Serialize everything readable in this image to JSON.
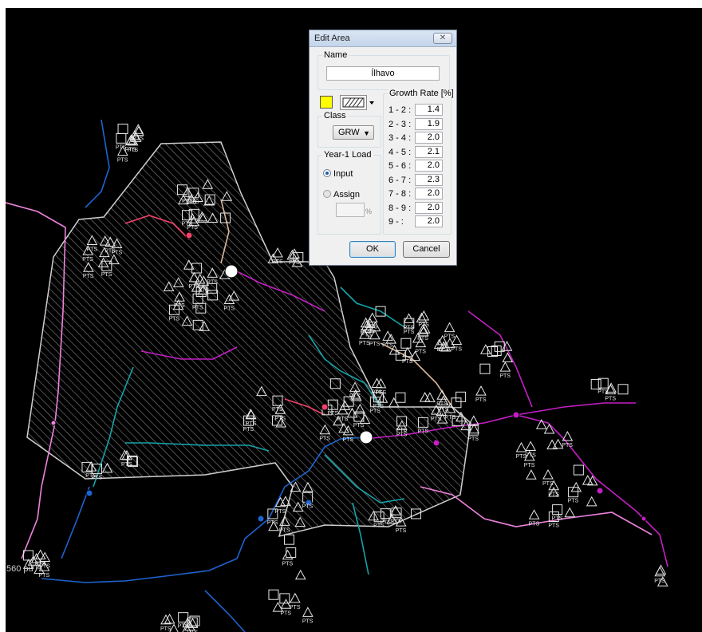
{
  "map": {
    "corner_label": "560 pu",
    "node_label": "PTS",
    "colors": {
      "background": "#000000",
      "area_outline": "#cfcfcf",
      "line_blue": "#1e64d0",
      "line_teal": "#15a3a8",
      "line_magenta": "#c41fc4",
      "line_pink": "#ee82dd",
      "line_tan": "#d9b79a",
      "line_red": "#f2426a"
    }
  },
  "dialog": {
    "title": "Edit Area",
    "close_glyph": "✕",
    "name_group_label": "Name",
    "name_value": "Ílhavo",
    "area_color": "#ffff00",
    "class_group_label": "Class",
    "class_value": "GRW",
    "year_load_label": "Year-1 Load",
    "input_option": "Input",
    "assign_option": "Assign",
    "assign_unit": "%",
    "growth_label": "Growth Rate [%]",
    "growth_rates": [
      {
        "period": "1 - 2 :",
        "value": "1.4"
      },
      {
        "period": "2 - 3 :",
        "value": "1.9"
      },
      {
        "period": "3 - 4 :",
        "value": "2.0"
      },
      {
        "period": "4 - 5 :",
        "value": "2.1"
      },
      {
        "period": "5 - 6 :",
        "value": "2.0"
      },
      {
        "period": "6 - 7 :",
        "value": "2.3"
      },
      {
        "period": "7 - 8 :",
        "value": "2.0"
      },
      {
        "period": "8 - 9 :",
        "value": "2.0"
      },
      {
        "period": "9 -    :",
        "value": "2.0"
      }
    ],
    "ok_label": "OK",
    "cancel_label": "Cancel"
  }
}
